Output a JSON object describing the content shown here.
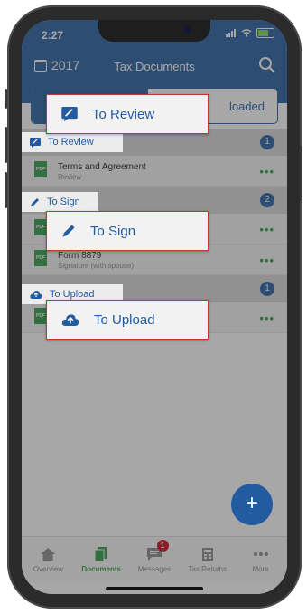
{
  "status": {
    "time": "2:27"
  },
  "header": {
    "year": "2017",
    "title": "Tax Documents"
  },
  "segments": [
    {
      "label": ""
    },
    {
      "label": "loaded"
    }
  ],
  "sections": [
    {
      "label": "To Review",
      "count": "1",
      "docs": [
        {
          "name": "Terms and Agreement",
          "sub": "Review"
        }
      ]
    },
    {
      "label": "To Sign",
      "count": "2",
      "docs": [
        {
          "name": "",
          "sub": ""
        },
        {
          "name": "Form 8879",
          "sub": "Signature (with spouse)"
        }
      ]
    },
    {
      "label": "To Upload",
      "count": "1",
      "docs": [
        {
          "name": "",
          "sub": ""
        }
      ]
    }
  ],
  "pdf_label": "PDF",
  "more_glyph": "•••",
  "callouts": {
    "review": "To Review",
    "sign": "To Sign",
    "upload": "To Upload"
  },
  "fab": "+",
  "tabs": [
    {
      "label": "Overview"
    },
    {
      "label": "Documents"
    },
    {
      "label": "Messages",
      "badge": "1"
    },
    {
      "label": "Tax Returns"
    },
    {
      "label": "More"
    }
  ],
  "colors": {
    "brand": "#235ba0",
    "accent": "#2e9a47",
    "badge": "#d0021b",
    "callout_border": "#c0392b"
  }
}
